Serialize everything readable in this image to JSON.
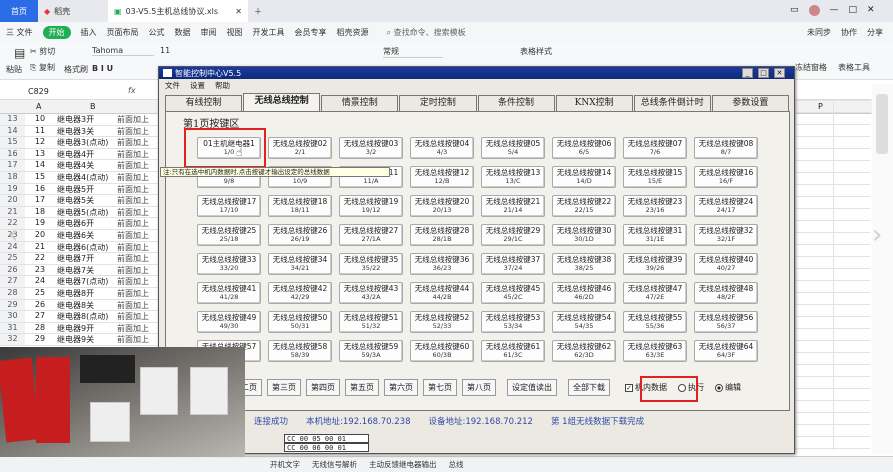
{
  "wps": {
    "tabs": [
      "首页",
      "稻壳",
      "03-V5.5主机总线协议.xls"
    ],
    "ribbon_tabs": [
      "三 文件",
      "开始",
      "插入",
      "页面布局",
      "公式",
      "数据",
      "审阅",
      "视图",
      "开发工具",
      "会员专享",
      "稻壳资源"
    ],
    "search_placeholder": "查找命令、搜索模板",
    "right_actions": [
      "未同步",
      "协作",
      "分享"
    ],
    "toolbar": {
      "cut": "剪切",
      "copy": "复制",
      "format_painter": "格式刷",
      "paste": "粘贴",
      "font": "Tahoma",
      "font_size": "11",
      "number_format": "常规",
      "table_style": "表格样式",
      "freeze": "冻结窗格",
      "table_tools": "表格工具"
    },
    "name_box": "C829",
    "fx": "fx",
    "col_headers": [
      "A",
      "B",
      "P"
    ],
    "rows": [
      {
        "n": "13",
        "a": "10",
        "b": "继电器3开",
        "c": "前面加上"
      },
      {
        "n": "14",
        "a": "11",
        "b": "继电器3关",
        "c": "前面加上"
      },
      {
        "n": "15",
        "a": "12",
        "b": "继电器3(点动)",
        "c": "前面加上"
      },
      {
        "n": "16",
        "a": "13",
        "b": "继电器4开",
        "c": "前面加上"
      },
      {
        "n": "17",
        "a": "14",
        "b": "继电器4关",
        "c": "前面加上"
      },
      {
        "n": "18",
        "a": "15",
        "b": "继电器4(点动)",
        "c": "前面加上"
      },
      {
        "n": "19",
        "a": "16",
        "b": "继电器5开",
        "c": "前面加上"
      },
      {
        "n": "20",
        "a": "17",
        "b": "继电器5关",
        "c": "前面加上"
      },
      {
        "n": "21",
        "a": "18",
        "b": "继电器5(点动)",
        "c": "前面加上"
      },
      {
        "n": "22",
        "a": "19",
        "b": "继电器6开",
        "c": "前面加上"
      },
      {
        "n": "23",
        "a": "20",
        "b": "继电器6关",
        "c": "前面加上"
      },
      {
        "n": "24",
        "a": "21",
        "b": "继电器6(点动)",
        "c": "前面加上"
      },
      {
        "n": "25",
        "a": "22",
        "b": "继电器7开",
        "c": "前面加上"
      },
      {
        "n": "26",
        "a": "23",
        "b": "继电器7关",
        "c": "前面加上"
      },
      {
        "n": "27",
        "a": "24",
        "b": "继电器7(点动)",
        "c": "前面加上"
      },
      {
        "n": "28",
        "a": "25",
        "b": "继电器8开",
        "c": "前面加上"
      },
      {
        "n": "29",
        "a": "26",
        "b": "继电器8关",
        "c": "前面加上"
      },
      {
        "n": "30",
        "a": "27",
        "b": "继电器8(点动)",
        "c": "前面加上"
      },
      {
        "n": "31",
        "a": "28",
        "b": "继电器9开",
        "c": "前面加上"
      },
      {
        "n": "32",
        "a": "29",
        "b": "继电器9关",
        "c": "前面加上"
      }
    ],
    "sheet_tabs": [
      "开机文字",
      "无线信号解析",
      "主动反馈继电器输出",
      "总线"
    ]
  },
  "dialog": {
    "title": "智能控制中心V5.5",
    "menu": [
      "文件",
      "设置",
      "帮助"
    ],
    "tabs": [
      "有线控制",
      "无线总线控制",
      "情景控制",
      "定时控制",
      "条件控制",
      "KNX控制",
      "总线条件倒计时",
      "参数设置"
    ],
    "active_tab": 1,
    "area_title": "第1页按键区",
    "tooltip": "注:只有在选中机内数据时,点击按键才输出设定的总线数据",
    "buttons": [
      {
        "name": "01主机继电器1",
        "sub": "1/0"
      },
      {
        "name": "无线总线按键02",
        "sub": "2/1"
      },
      {
        "name": "无线总线按键03",
        "sub": "3/2"
      },
      {
        "name": "无线总线按键04",
        "sub": "4/3"
      },
      {
        "name": "无线总线按键05",
        "sub": "5/4"
      },
      {
        "name": "无线总线按键06",
        "sub": "6/5"
      },
      {
        "name": "无线总线按键07",
        "sub": "7/6"
      },
      {
        "name": "无线总线按键08",
        "sub": "8/7"
      },
      {
        "name": "无线总线按键09",
        "sub": "9/8"
      },
      {
        "name": "无线总线按键10",
        "sub": "10/9"
      },
      {
        "name": "无线总线按键11",
        "sub": "11/A"
      },
      {
        "name": "无线总线按键12",
        "sub": "12/B"
      },
      {
        "name": "无线总线按键13",
        "sub": "13/C"
      },
      {
        "name": "无线总线按键14",
        "sub": "14/D"
      },
      {
        "name": "无线总线按键15",
        "sub": "15/E"
      },
      {
        "name": "无线总线按键16",
        "sub": "16/F"
      },
      {
        "name": "无线总线按键17",
        "sub": "17/10"
      },
      {
        "name": "无线总线按键18",
        "sub": "18/11"
      },
      {
        "name": "无线总线按键19",
        "sub": "19/12"
      },
      {
        "name": "无线总线按键20",
        "sub": "20/13"
      },
      {
        "name": "无线总线按键21",
        "sub": "21/14"
      },
      {
        "name": "无线总线按键22",
        "sub": "22/15"
      },
      {
        "name": "无线总线按键23",
        "sub": "23/16"
      },
      {
        "name": "无线总线按键24",
        "sub": "24/17"
      },
      {
        "name": "无线总线按键25",
        "sub": "25/18"
      },
      {
        "name": "无线总线按键26",
        "sub": "26/19"
      },
      {
        "name": "无线总线按键27",
        "sub": "27/1A"
      },
      {
        "name": "无线总线按键28",
        "sub": "28/1B"
      },
      {
        "name": "无线总线按键29",
        "sub": "29/1C"
      },
      {
        "name": "无线总线按键30",
        "sub": "30/1D"
      },
      {
        "name": "无线总线按键31",
        "sub": "31/1E"
      },
      {
        "name": "无线总线按键32",
        "sub": "32/1F"
      },
      {
        "name": "无线总线按键33",
        "sub": "33/20"
      },
      {
        "name": "无线总线按键34",
        "sub": "34/21"
      },
      {
        "name": "无线总线按键35",
        "sub": "35/22"
      },
      {
        "name": "无线总线按键36",
        "sub": "36/23"
      },
      {
        "name": "无线总线按键37",
        "sub": "37/24"
      },
      {
        "name": "无线总线按键38",
        "sub": "38/25"
      },
      {
        "name": "无线总线按键39",
        "sub": "39/26"
      },
      {
        "name": "无线总线按键40",
        "sub": "40/27"
      },
      {
        "name": "无线总线按键41",
        "sub": "41/28"
      },
      {
        "name": "无线总线按键42",
        "sub": "42/29"
      },
      {
        "name": "无线总线按键43",
        "sub": "43/2A"
      },
      {
        "name": "无线总线按键44",
        "sub": "44/2B"
      },
      {
        "name": "无线总线按键45",
        "sub": "45/2C"
      },
      {
        "name": "无线总线按键46",
        "sub": "46/2D"
      },
      {
        "name": "无线总线按键47",
        "sub": "47/2E"
      },
      {
        "name": "无线总线按键48",
        "sub": "48/2F"
      },
      {
        "name": "无线总线按键49",
        "sub": "49/30"
      },
      {
        "name": "无线总线按键50",
        "sub": "50/31"
      },
      {
        "name": "无线总线按键51",
        "sub": "51/32"
      },
      {
        "name": "无线总线按键52",
        "sub": "52/33"
      },
      {
        "name": "无线总线按键53",
        "sub": "53/34"
      },
      {
        "name": "无线总线按键54",
        "sub": "54/35"
      },
      {
        "name": "无线总线按键55",
        "sub": "55/36"
      },
      {
        "name": "无线总线按键56",
        "sub": "56/37"
      },
      {
        "name": "无线总线按键57",
        "sub": "57/38"
      },
      {
        "name": "无线总线按键58",
        "sub": "58/39"
      },
      {
        "name": "无线总线按键59",
        "sub": "59/3A"
      },
      {
        "name": "无线总线按键60",
        "sub": "60/3B"
      },
      {
        "name": "无线总线按键61",
        "sub": "61/3C"
      },
      {
        "name": "无线总线按键62",
        "sub": "62/3D"
      },
      {
        "name": "无线总线按键63",
        "sub": "63/3E"
      },
      {
        "name": "无线总线按键64",
        "sub": "64/3F"
      }
    ],
    "page_buttons": [
      "二页",
      "第三页",
      "第四页",
      "第五页",
      "第六页",
      "第七页",
      "第八页"
    ],
    "read_button": "设定值读出",
    "download_button": "全部下载",
    "machine_data_label": "机内数据",
    "machine_data_checked": true,
    "execute_label": "执行",
    "edit_label": "编辑",
    "status": {
      "conn": "连接成功",
      "host_addr": "本机地址:192.168.70.238",
      "dev_addr": "设备地址:192.168.70.212",
      "msg": "第 1组无线数据下载完成"
    }
  },
  "cell_rows": [
    "CC 00 05 00 01",
    "CC 00 06 00 01"
  ]
}
